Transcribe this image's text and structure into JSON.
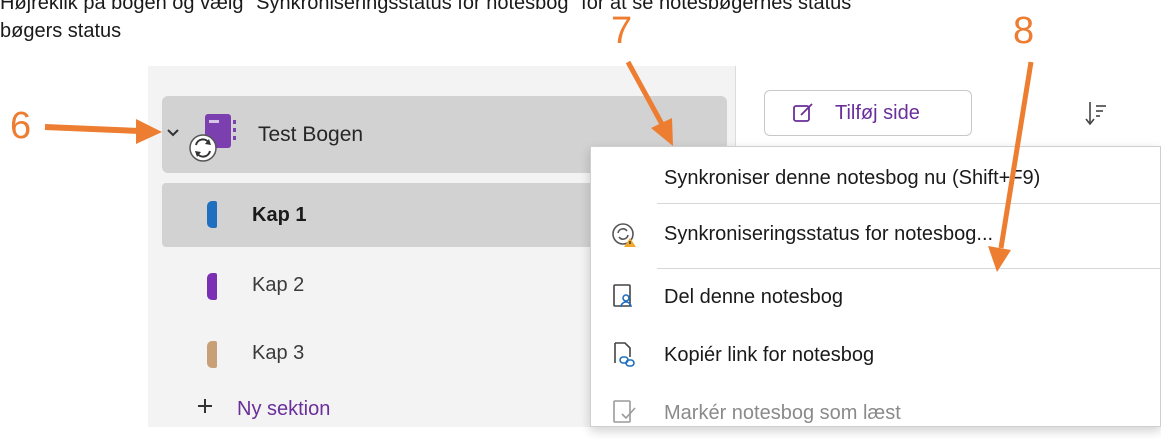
{
  "document": {
    "line1": "Højreklik på bogen og vælg \"Synkroniseringsstatus for notesbog\" for at se notesbøgernes status",
    "line2": "bøgers status"
  },
  "callouts": {
    "c6": "6",
    "c7": "7",
    "c8": "8"
  },
  "accent_color": "#ed7d31",
  "notebook": {
    "title": "Test Bogen",
    "icon": "notebook-sync-icon",
    "color": "#7b3fb0",
    "sections": [
      {
        "label": "Kap 1",
        "color": "#1f6fc0",
        "selected": true
      },
      {
        "label": "Kap 2",
        "color": "#7a2fb5",
        "selected": false
      },
      {
        "label": "Kap 3",
        "color": "#c8a078",
        "selected": false
      }
    ],
    "new_section_label": "Ny sektion"
  },
  "toolbar": {
    "add_page_label": "Tilføj side",
    "add_page_icon": "edit-icon",
    "sort_icon": "sort-icon"
  },
  "context_menu": {
    "items": [
      {
        "label": "Synkroniser denne notesbog nu (Shift+F9)",
        "icon": "",
        "disabled": false
      },
      {
        "label": "Synkroniseringsstatus for notesbog...",
        "icon": "sync-status-icon",
        "disabled": false
      },
      {
        "label": "Del denne notesbog",
        "icon": "share-notebook-icon",
        "disabled": false
      },
      {
        "label": "Kopiér link for notesbog",
        "icon": "copy-link-icon",
        "disabled": false
      },
      {
        "label": "Markér notesbog som læst",
        "icon": "mark-read-icon",
        "disabled": true
      }
    ]
  }
}
